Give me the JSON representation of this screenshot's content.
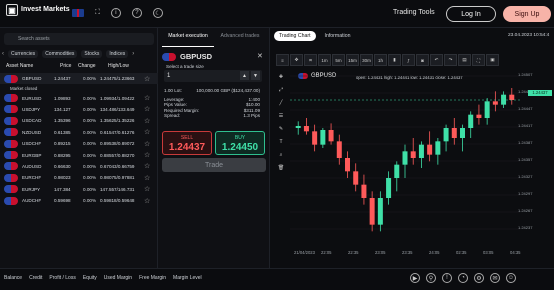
{
  "header": {
    "logo_text": "Invest Markets",
    "trading_tools": "Trading Tools",
    "login": "Log In",
    "signup": "Sign Up"
  },
  "left": {
    "search_placeholder": "Search assets",
    "categories": [
      "Currencies",
      "Commodities",
      "Stocks",
      "Indices"
    ],
    "columns": {
      "name": "Asset Name",
      "price": "Price",
      "change": "Change",
      "hl": "High/Low"
    },
    "market_closed": "Market closed",
    "rows": [
      {
        "sym": "GBPUSD",
        "price": "1.24437",
        "chg": "0.00%",
        "hl": "1.24475/1.23663"
      },
      {
        "sym": "EURUSD",
        "price": "1.09893",
        "chg": "0.00%",
        "hl": "1.09934/1.09422"
      },
      {
        "sym": "USDJPY",
        "price": "134.127",
        "chg": "0.00%",
        "hl": "134.486/133.649"
      },
      {
        "sym": "USDCAD",
        "price": "1.35396",
        "chg": "0.00%",
        "hl": "1.35625/1.35226"
      },
      {
        "sym": "NZDUSD",
        "price": "0.61385",
        "chg": "0.00%",
        "hl": "0.61547/0.61276"
      },
      {
        "sym": "USDCHF",
        "price": "0.89215",
        "chg": "0.00%",
        "hl": "0.89538/0.89072"
      },
      {
        "sym": "EURGBP",
        "price": "0.88295",
        "chg": "0.00%",
        "hl": "0.88557/0.88270"
      },
      {
        "sym": "AUDUSD",
        "price": "0.66630",
        "chg": "0.00%",
        "hl": "0.67043/0.66759"
      },
      {
        "sym": "EURCHF",
        "price": "0.98023",
        "chg": "0.00%",
        "hl": "0.98075/0.97881"
      },
      {
        "sym": "EURJPY",
        "price": "147.384",
        "chg": "0.00%",
        "hl": "147.557/146.731"
      },
      {
        "sym": "AUDCHF",
        "price": "0.59698",
        "chg": "0.00%",
        "hl": "0.59818/0.59648"
      }
    ]
  },
  "mid": {
    "tab_market": "Market execution",
    "tab_adv": "Advanced trades",
    "pair": "GBPUSD",
    "size_label": "Select a trade size",
    "size_value": "1",
    "info": [
      {
        "k": "1.00 Lot:",
        "v": "100,000.00 GBP ($124,437.00)"
      },
      {
        "k": "Leverage:",
        "v": "1:400"
      },
      {
        "k": "Pips Value:",
        "v": "$10.00"
      },
      {
        "k": "Required Margin:",
        "v": "$311.09"
      },
      {
        "k": "Spread:",
        "v": "1.3 Pips"
      }
    ],
    "sell_label": "SELL",
    "sell_price": "1.24437",
    "buy_label": "BUY",
    "buy_price": "1.24450",
    "trade": "Trade"
  },
  "chart": {
    "tab_active": "Trading Chart",
    "tab_info": "Information",
    "datetime": "23.04.2023 10:54:4",
    "pair": "GBPUSD",
    "ohlc": "open: 1.24431 high: 1.24441 low: 1.24431 close: 1.24437",
    "timeframes": [
      "1m",
      "5m",
      "15m",
      "30m",
      "1h"
    ],
    "price_tag": "1.24437",
    "y_ticks": [
      "1.24507",
      "1.24477",
      "1.24447",
      "1.24417",
      "1.24387",
      "1.24357",
      "1.24327",
      "1.24297",
      "1.24267",
      "1.24237"
    ],
    "x_ticks": [
      "21/04/2023",
      "22:05",
      "22:35",
      "23:05",
      "23:35",
      "24:05",
      "02:35",
      "03:05",
      "04:35"
    ]
  },
  "chart_data": {
    "type": "candlestick",
    "title": "GBPUSD",
    "candles": [
      [
        1.24395,
        1.24405,
        1.24385,
        1.24398
      ],
      [
        1.24398,
        1.2441,
        1.24385,
        1.2439
      ],
      [
        1.2439,
        1.244,
        1.2436,
        1.2437
      ],
      [
        1.2437,
        1.24395,
        1.24365,
        1.24392
      ],
      [
        1.24392,
        1.24402,
        1.2437,
        1.24375
      ],
      [
        1.24375,
        1.24385,
        1.2434,
        1.2435
      ],
      [
        1.2435,
        1.2436,
        1.2432,
        1.2433
      ],
      [
        1.2433,
        1.24342,
        1.243,
        1.2431
      ],
      [
        1.2431,
        1.24325,
        1.2428,
        1.2429
      ],
      [
        1.2429,
        1.243,
        1.2424,
        1.2425
      ],
      [
        1.2425,
        1.243,
        1.2424,
        1.2429
      ],
      [
        1.2429,
        1.2433,
        1.2428,
        1.2432
      ],
      [
        1.2432,
        1.24345,
        1.243,
        1.2434
      ],
      [
        1.2434,
        1.2437,
        1.2432,
        1.2436
      ],
      [
        1.2436,
        1.2438,
        1.2434,
        1.2435
      ],
      [
        1.2435,
        1.24375,
        1.24335,
        1.2437
      ],
      [
        1.2437,
        1.2439,
        1.24345,
        1.24355
      ],
      [
        1.24355,
        1.2438,
        1.2434,
        1.24375
      ],
      [
        1.24375,
        1.244,
        1.2436,
        1.24395
      ],
      [
        1.24395,
        1.2441,
        1.2437,
        1.2438
      ],
      [
        1.2438,
        1.244,
        1.2436,
        1.24395
      ],
      [
        1.24395,
        1.2442,
        1.2438,
        1.24415
      ],
      [
        1.24415,
        1.2443,
        1.244,
        1.2441
      ],
      [
        1.2441,
        1.2444,
        1.244,
        1.24435
      ],
      [
        1.24435,
        1.2445,
        1.2442,
        1.2443
      ],
      [
        1.2443,
        1.2445,
        1.24425,
        1.24445
      ],
      [
        1.24445,
        1.24455,
        1.2443,
        1.24437
      ]
    ]
  },
  "footer": [
    "Balance",
    "Credit",
    "Profit / Loss",
    "Equity",
    "Used Margin",
    "Free Margin",
    "Margin Level"
  ]
}
